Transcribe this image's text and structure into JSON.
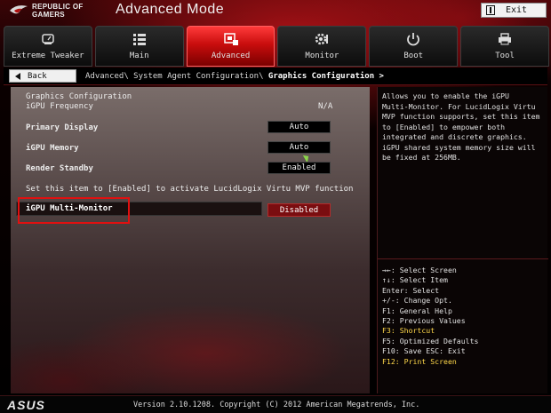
{
  "header": {
    "brand_line1": "REPUBLIC OF",
    "brand_line2": "GAMERS",
    "mode_title": "Advanced Mode",
    "exit_label": "Exit"
  },
  "tabs": [
    {
      "label": "Extreme Tweaker",
      "icon": "meter-icon"
    },
    {
      "label": "Main",
      "icon": "list-icon"
    },
    {
      "label": "Advanced",
      "icon": "chip-icon",
      "active": true
    },
    {
      "label": "Monitor",
      "icon": "gear-monitor-icon"
    },
    {
      "label": "Boot",
      "icon": "power-icon"
    },
    {
      "label": "Tool",
      "icon": "printer-icon"
    }
  ],
  "nav": {
    "back_label": "Back",
    "breadcrumb_path": "Advanced\\ System Agent Configuration\\ ",
    "breadcrumb_current": "Graphics Configuration >"
  },
  "main": {
    "section_title": "Graphics Configuration",
    "igpu_frequency_label": "iGPU Frequency",
    "igpu_frequency_value": "N/A",
    "primary_display_label": "Primary Display",
    "primary_display_value": "Auto",
    "igpu_memory_label": "iGPU Memory",
    "igpu_memory_value": "Auto",
    "render_standby_label": "Render Standby",
    "render_standby_value": "Enabled",
    "lucid_note": "Set this item to [Enabled] to activate LucidLogix Virtu MVP function",
    "multi_monitor_label": "iGPU Multi-Monitor",
    "multi_monitor_value": "Disabled"
  },
  "help": {
    "text": "Allows you to enable the iGPU\nMulti-Monitor. For LucidLogix Virtu\nMVP function supports, set this item\nto [Enabled] to empower both\nintegrated and discrete graphics.\niGPU shared system memory size will\nbe fixed at 256MB."
  },
  "keys": [
    "→←: Select Screen",
    "↑↓: Select Item",
    "Enter: Select",
    "+/-: Change Opt.",
    "F1: General Help",
    "F2: Previous Values",
    "F3: Shortcut",
    "F5: Optimized Defaults",
    "F10: Save  ESC: Exit",
    "F12: Print Screen"
  ],
  "footer": {
    "brand": "ASUS",
    "version": "Version 2.10.1208. Copyright (C) 2012 American Megatrends, Inc."
  },
  "colors": {
    "accent_red": "#c80d0d",
    "highlight_yellow": "#ffd84a",
    "selection_frame": "#e01010"
  }
}
